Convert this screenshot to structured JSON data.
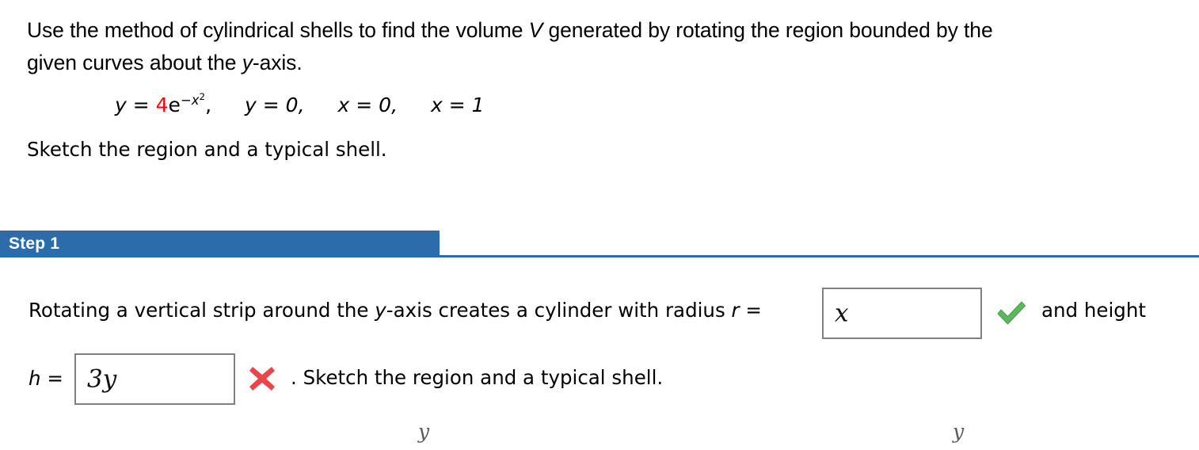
{
  "problem": {
    "line1_a": "Use the method of cylindrical shells to find the volume ",
    "line1_var": "V",
    "line1_b": " generated by rotating the region bounded by the",
    "line2_a": "given curves about the ",
    "line2_var": "y",
    "line2_b": "-axis.",
    "sketch_instruction": "Sketch the region and a typical shell."
  },
  "equation": {
    "lhs_var": "y",
    "equals": " = ",
    "coefficient": "4",
    "base": "e",
    "exponent_sign": "−",
    "exponent_var": "x",
    "exponent_power": "2",
    "comma": ",",
    "term2": "y = 0,",
    "term3": "x = 0,",
    "term4": "x = 1",
    "coefficient_color": "#ff0000"
  },
  "step": {
    "label": "Step 1",
    "header_color": "#2d6cab",
    "body_prefix": "Rotating a vertical strip around the ",
    "body_var1": "y",
    "body_mid": "-axis creates a cylinder with radius ",
    "body_var2": "r",
    "body_equals": " =",
    "and_height": "and height",
    "h_var": "h",
    "h_equals": " =",
    "tail": ". Sketch the region and a typical shell."
  },
  "answers": {
    "radius_value": "x",
    "radius_status": "correct",
    "radius_status_color": "#5cb85c",
    "height_value": "3y",
    "height_status": "incorrect",
    "height_status_color": "#e8464a"
  },
  "graphs": {
    "left_axis_label": "y",
    "right_axis_label": "y"
  }
}
